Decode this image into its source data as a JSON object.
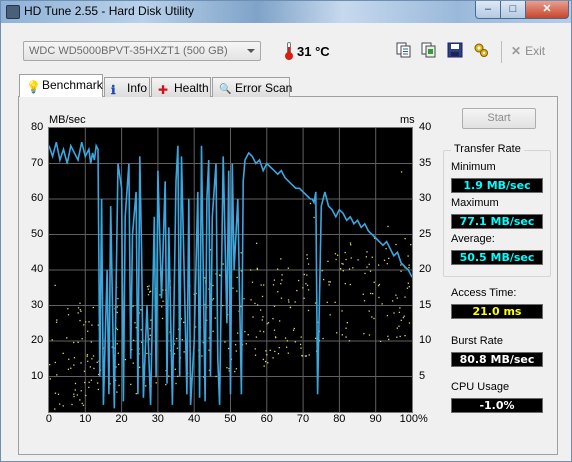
{
  "window": {
    "title": "HD Tune 2.55 - Hard Disk Utility",
    "min": "–",
    "max": "□",
    "close": "✕"
  },
  "toolbar": {
    "drive": "WDC WD5000BPVT-35HXZT1 (500 GB)",
    "temperature": "31 °C",
    "icons": [
      "copy-text-icon",
      "copy-screenshot-icon",
      "save-icon",
      "options-icon"
    ],
    "exit_label": "Exit"
  },
  "tabs": [
    {
      "label": "Benchmark",
      "icon": "benchmark-icon",
      "glyph": "💡",
      "active": true
    },
    {
      "label": "Info",
      "icon": "info-icon",
      "glyph": "ℹ",
      "active": false
    },
    {
      "label": "Health",
      "icon": "health-icon",
      "glyph": "✚",
      "active": false
    },
    {
      "label": "Error Scan",
      "icon": "error-scan-icon",
      "glyph": "🔍",
      "active": false
    }
  ],
  "benchmark": {
    "start_label": "Start",
    "transfer_rate_title": "Transfer Rate",
    "minimum_label": "Minimum",
    "minimum_value": "1.9 MB/sec",
    "maximum_label": "Maximum",
    "maximum_value": "77.1 MB/sec",
    "average_label": "Average:",
    "average_value": "50.5 MB/sec",
    "access_label": "Access Time:",
    "access_value": "21.0 ms",
    "burst_label": "Burst Rate",
    "burst_value": "80.8 MB/sec",
    "cpu_label": "CPU Usage",
    "cpu_value": "-1.0%",
    "colors": {
      "transfer": "#00ffff",
      "access": "#ffff00",
      "burst": "#ffffff",
      "cpu": "#ffffff",
      "line": "#3aa7e0",
      "dots": "#d8d860"
    }
  },
  "chart_data": {
    "type": "line",
    "y_left_unit": "MB/sec",
    "y_right_unit": "ms",
    "y_left_ticks": [
      "80",
      "70",
      "60",
      "50",
      "40",
      "30",
      "20",
      "10"
    ],
    "y_right_ticks": [
      "40",
      "35",
      "30",
      "25",
      "20",
      "15",
      "10",
      "5"
    ],
    "x_ticks": [
      "0",
      "10",
      "20",
      "30",
      "40",
      "50",
      "60",
      "70",
      "80",
      "90",
      "100%"
    ],
    "xlim": [
      0,
      100
    ],
    "ylim_left": [
      0,
      80
    ],
    "ylim_right": [
      0,
      40
    ],
    "grid": true,
    "series": [
      {
        "values_x": [
          0,
          1,
          2,
          3,
          4,
          5,
          6,
          7,
          8,
          9,
          10,
          11,
          11.5,
          12,
          12.5,
          13,
          13.5,
          14,
          14.5,
          15,
          16,
          16.5,
          17,
          18,
          19,
          20,
          20.5,
          21,
          22,
          22.5,
          23,
          24,
          24.5,
          25,
          25.5,
          26,
          27,
          28,
          29,
          29.5,
          30,
          31,
          32,
          32.5,
          33,
          34,
          35,
          35.5,
          36,
          36.5,
          37,
          38,
          38.5,
          39,
          40,
          41,
          41.5,
          42,
          43,
          43.5,
          44,
          44.5,
          45,
          46,
          46.5,
          47,
          48,
          49,
          49.5,
          50,
          50.5,
          51,
          52,
          53,
          53.5,
          54,
          55,
          56,
          57,
          58,
          59,
          60,
          61,
          62,
          63,
          64,
          65,
          66,
          67,
          68,
          69,
          70,
          71,
          72,
          72.5,
          73,
          73.5,
          74,
          75,
          76,
          77,
          78,
          79,
          80,
          81,
          82,
          83,
          84,
          85,
          86,
          87,
          88,
          89,
          90,
          91,
          92,
          93,
          94,
          95,
          96,
          97,
          98,
          99,
          100
        ],
        "values_y": [
          75,
          72,
          76,
          71,
          74,
          70,
          75,
          73,
          71,
          76,
          72,
          74,
          70,
          73,
          71,
          75,
          74,
          10,
          60,
          2,
          40,
          5,
          58,
          1,
          70,
          63,
          3,
          55,
          70,
          15,
          50,
          62,
          5,
          72,
          45,
          4,
          30,
          2,
          55,
          10,
          68,
          32,
          65,
          8,
          52,
          2,
          65,
          75,
          10,
          72,
          50,
          5,
          60,
          2,
          20,
          62,
          4,
          75,
          3,
          60,
          71,
          10,
          55,
          70,
          15,
          2,
          72,
          25,
          68,
          5,
          70,
          40,
          60,
          5,
          65,
          71,
          73,
          72,
          70,
          71,
          68,
          70,
          69,
          68,
          67,
          68,
          66,
          65,
          64,
          63,
          63,
          62,
          61,
          60,
          60,
          59,
          62,
          5,
          58,
          62,
          58,
          57,
          55,
          57,
          56,
          54,
          55,
          53,
          54,
          52,
          53,
          51,
          50,
          49,
          48,
          47,
          48,
          46,
          44,
          45,
          42,
          41,
          40,
          38
        ],
        "name": ""
      }
    ]
  }
}
